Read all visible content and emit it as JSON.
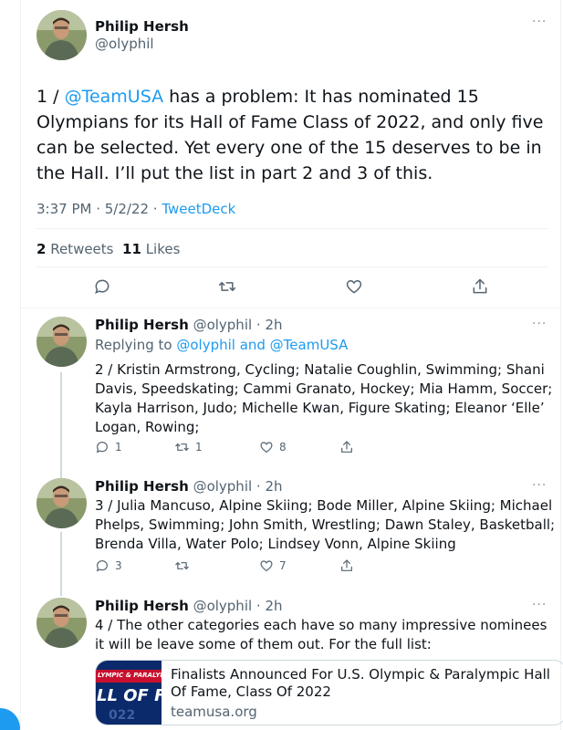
{
  "main_tweet": {
    "author_name": "Philip Hersh",
    "author_handle": "@olyphil",
    "more": "···",
    "text_prefix": "1 / ",
    "mention": "@TeamUSA",
    "text_rest": " has a problem: It has nominated 15 Olympians for its Hall of Fame Class of 2022, and only five can be selected.  Yet every one of the 15 deserves to be in the Hall.  I’ll put the list in part 2 and 3 of this.",
    "time": "3:37 PM · 5/2/22 · ",
    "source": "TweetDeck",
    "retweet_count": "2",
    "retweet_label": " Retweets",
    "like_count": "11",
    "like_label": " Likes",
    "actions": [
      "reply-icon",
      "retweet-icon",
      "like-icon",
      "share-icon"
    ]
  },
  "replies": [
    {
      "author_name": "Philip Hersh",
      "author_meta": " @olyphil · 2h",
      "more": "···",
      "replying_prefix": "Replying to ",
      "replying_to": "@olyphil and @TeamUSA",
      "text": "2 / Kristin Armstrong, Cycling; Natalie Coughlin, Swimming; Shani Davis, Speedskating; Cammi Granato, Hockey; Mia Hamm, Soccer; Kayla Harrison, Judo; Michelle Kwan, Figure Skating; Eleanor ‘Elle’ Logan, Rowing;",
      "reply_count": "1",
      "retweet_count": "1",
      "like_count": "8"
    },
    {
      "author_name": "Philip Hersh",
      "author_meta": " @olyphil · 2h",
      "more": "···",
      "text": "3 / Julia Mancuso, Alpine Skiing; Bode Miller, Alpine Skiing; Michael Phelps, Swimming; John Smith, Wrestling; Dawn Staley, Basketball; Brenda Villa, Water Polo; Lindsey Vonn, Alpine Skiing",
      "reply_count": "3",
      "retweet_count": "",
      "like_count": "7"
    },
    {
      "author_name": "Philip Hersh",
      "author_meta": " @olyphil · 2h",
      "more": "···",
      "text": "4 / The other categories each have so many impressive nominees it will be leave some of them out.  For the full list:",
      "card": {
        "image_text_top": "LYMPIC & PARALYMPIC",
        "image_text_main": "LL OF FA",
        "image_text_bottom": "022",
        "title": "Finalists Announced For U.S. Olympic & Paralympic Hall Of Fame, Class Of 2022",
        "domain": "teamusa.org"
      }
    }
  ],
  "colors": {
    "accent": "#1d9bf0",
    "text": "#0f1419",
    "secondary": "#536471",
    "border": "#eff3f4"
  }
}
